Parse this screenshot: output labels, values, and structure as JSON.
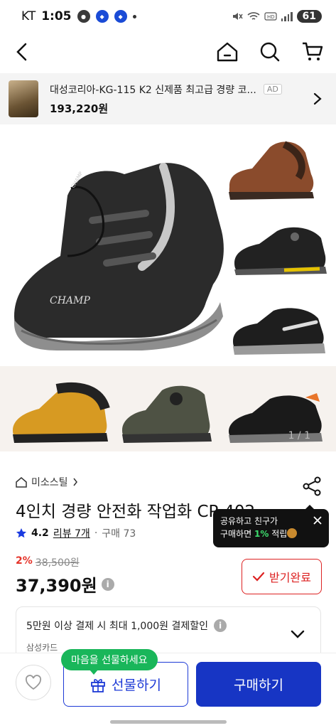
{
  "status_bar": {
    "carrier": "KT",
    "time": "1:05",
    "battery": "61"
  },
  "mini_banner": {
    "title": "대성코리아-KG-115 K2 신제품 최고급 경량 코...",
    "ad_label": "AD",
    "price": "193,220원"
  },
  "hero": {
    "counter": "1 / 1",
    "logo_text": "CHAMP"
  },
  "product": {
    "brand": "미소스틸",
    "title": "4인치 경량 안전화 작업화 CP-402",
    "rating": "4.2",
    "reviews": "리뷰 7개",
    "purchases": "구매 73",
    "discount_pct": "2%",
    "original_price": "38,500원",
    "final_price": "37,390원",
    "coupon_label": "받기완료"
  },
  "tooltip": {
    "line1": "공유하고 친구가",
    "line2_prefix": "구매하면",
    "line2_pct": "1%",
    "line2_suffix": "적립"
  },
  "benefit": {
    "text": "5만원 이상 결제 시 최대 1,000원 결제할인",
    "card": "삼성카드"
  },
  "bottom": {
    "gift_pill": "마음을 선물하세요",
    "gift_button": "선물하기",
    "buy_button": "구매하기"
  },
  "colors": {
    "primary_blue": "#1735c4",
    "accent_red": "#e5342a",
    "gift_green": "#19b65a"
  }
}
